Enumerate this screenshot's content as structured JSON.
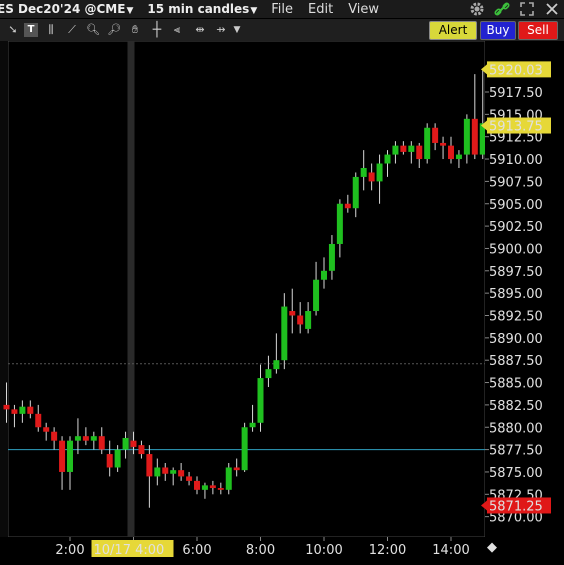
{
  "titlebar": {
    "symbol": "ES Dec20'24 @CME",
    "interval": "15 min candles",
    "menu": [
      "File",
      "Edit",
      "View"
    ]
  },
  "toolbar": {
    "tools": [
      "arrow-cursor-icon",
      "text-tool-icon",
      "bar-tool-icon",
      "line-tool-icon",
      "zoom-in-icon",
      "zoom-out-icon",
      "pan-hand-icon",
      "crosshair-icon",
      "compare-icon",
      "expand-icon",
      "dropdown-icon"
    ],
    "alert_label": "Alert",
    "buy_label": "Buy",
    "sell_label": "Sell"
  },
  "colors": {
    "up": "#1fc01f",
    "down": "#e01a1a",
    "last_price_bg": "#e6d838",
    "sell_price_bg": "#e01818",
    "grid": "#1a1a1a",
    "reference_line": "#2fa0c0",
    "date_highlight_bg": "#e6d838"
  },
  "chart_data": {
    "type": "candlestick",
    "price_ticks": [
      "5917.50",
      "5915.00",
      "5912.50",
      "5910.00",
      "5907.50",
      "5905.00",
      "5902.50",
      "5900.00",
      "5897.50",
      "5895.00",
      "5892.50",
      "5890.00",
      "5887.50",
      "5885.00",
      "5882.50",
      "5880.00",
      "5877.50",
      "5875.00",
      "5872.50",
      "5870.00"
    ],
    "time_ticks": [
      "2:00",
      "4:00",
      "6:00",
      "8:00",
      "10:00",
      "12:00",
      "14:00"
    ],
    "price_labels": {
      "high_marker": "5920.03",
      "last_price": "5913.75",
      "sell_price": "5871.25"
    },
    "reference_price": 5877.5,
    "dashed_level": 5887.1,
    "date_label": "10/17",
    "candles": [
      {
        "t": "0:00",
        "o": 5882.5,
        "h": 5885.0,
        "l": 5880.5,
        "c": 5882.0
      },
      {
        "t": "0:15",
        "o": 5882.0,
        "h": 5882.5,
        "l": 5880.0,
        "c": 5881.5
      },
      {
        "t": "0:30",
        "o": 5881.5,
        "h": 5883.0,
        "l": 5880.5,
        "c": 5882.3
      },
      {
        "t": "0:45",
        "o": 5882.3,
        "h": 5883.0,
        "l": 5881.0,
        "c": 5881.5
      },
      {
        "t": "1:00",
        "o": 5881.5,
        "h": 5882.5,
        "l": 5879.5,
        "c": 5880.0
      },
      {
        "t": "1:15",
        "o": 5880.0,
        "h": 5880.5,
        "l": 5878.5,
        "c": 5879.5
      },
      {
        "t": "1:30",
        "o": 5879.5,
        "h": 5880.0,
        "l": 5877.5,
        "c": 5878.5
      },
      {
        "t": "1:45",
        "o": 5878.5,
        "h": 5879.0,
        "l": 5873.0,
        "c": 5875.0
      },
      {
        "t": "2:00",
        "o": 5875.0,
        "h": 5879.0,
        "l": 5873.0,
        "c": 5878.5
      },
      {
        "t": "2:15",
        "o": 5878.5,
        "h": 5881.0,
        "l": 5877.0,
        "c": 5879.0
      },
      {
        "t": "2:30",
        "o": 5879.0,
        "h": 5880.0,
        "l": 5878.0,
        "c": 5878.5
      },
      {
        "t": "2:45",
        "o": 5878.5,
        "h": 5879.5,
        "l": 5877.5,
        "c": 5879.0
      },
      {
        "t": "3:00",
        "o": 5879.0,
        "h": 5880.0,
        "l": 5877.0,
        "c": 5877.5
      },
      {
        "t": "3:15",
        "o": 5877.0,
        "h": 5878.5,
        "l": 5874.5,
        "c": 5875.5
      },
      {
        "t": "3:30",
        "o": 5875.5,
        "h": 5878.0,
        "l": 5875.0,
        "c": 5877.5
      },
      {
        "t": "3:45",
        "o": 5877.5,
        "h": 5879.5,
        "l": 5876.5,
        "c": 5878.8
      },
      {
        "t": "4:00",
        "o": 5878.5,
        "h": 5879.5,
        "l": 5877.0,
        "c": 5877.8
      },
      {
        "t": "4:15",
        "o": 5878.0,
        "h": 5878.5,
        "l": 5876.5,
        "c": 5877.0
      },
      {
        "t": "4:30",
        "o": 5877.0,
        "h": 5878.0,
        "l": 5871.0,
        "c": 5874.5
      },
      {
        "t": "4:45",
        "o": 5874.5,
        "h": 5876.5,
        "l": 5873.5,
        "c": 5875.5
      },
      {
        "t": "5:00",
        "o": 5875.5,
        "h": 5876.0,
        "l": 5874.0,
        "c": 5874.8
      },
      {
        "t": "5:15",
        "o": 5874.8,
        "h": 5875.5,
        "l": 5873.5,
        "c": 5875.2
      },
      {
        "t": "5:30",
        "o": 5875.2,
        "h": 5876.0,
        "l": 5874.0,
        "c": 5874.5
      },
      {
        "t": "5:45",
        "o": 5874.5,
        "h": 5875.0,
        "l": 5873.5,
        "c": 5874.0
      },
      {
        "t": "6:00",
        "o": 5874.0,
        "h": 5874.5,
        "l": 5872.5,
        "c": 5873.0
      },
      {
        "t": "6:15",
        "o": 5873.0,
        "h": 5873.8,
        "l": 5872.0,
        "c": 5873.5
      },
      {
        "t": "6:30",
        "o": 5873.5,
        "h": 5874.0,
        "l": 5872.5,
        "c": 5873.2
      },
      {
        "t": "6:45",
        "o": 5873.2,
        "h": 5873.8,
        "l": 5872.5,
        "c": 5873.0
      },
      {
        "t": "7:00",
        "o": 5873.0,
        "h": 5876.0,
        "l": 5872.5,
        "c": 5875.5
      },
      {
        "t": "7:15",
        "o": 5875.5,
        "h": 5876.5,
        "l": 5874.5,
        "c": 5875.2
      },
      {
        "t": "7:30",
        "o": 5875.2,
        "h": 5880.5,
        "l": 5875.0,
        "c": 5880.0
      },
      {
        "t": "7:45",
        "o": 5880.0,
        "h": 5882.5,
        "l": 5879.5,
        "c": 5880.5
      },
      {
        "t": "8:00",
        "o": 5880.5,
        "h": 5887.0,
        "l": 5879.5,
        "c": 5885.5
      },
      {
        "t": "8:15",
        "o": 5885.5,
        "h": 5888.0,
        "l": 5884.5,
        "c": 5886.5
      },
      {
        "t": "8:30",
        "o": 5886.5,
        "h": 5890.5,
        "l": 5886.0,
        "c": 5887.5
      },
      {
        "t": "8:45",
        "o": 5887.5,
        "h": 5895.0,
        "l": 5886.5,
        "c": 5893.5
      },
      {
        "t": "9:00",
        "o": 5893.0,
        "h": 5895.5,
        "l": 5890.5,
        "c": 5892.5
      },
      {
        "t": "9:15",
        "o": 5892.5,
        "h": 5894.0,
        "l": 5890.5,
        "c": 5891.5
      },
      {
        "t": "9:30",
        "o": 5891.0,
        "h": 5894.0,
        "l": 5890.5,
        "c": 5893.0
      },
      {
        "t": "9:45",
        "o": 5893.0,
        "h": 5898.5,
        "l": 5892.5,
        "c": 5896.5
      },
      {
        "t": "10:00",
        "o": 5896.5,
        "h": 5899.0,
        "l": 5895.5,
        "c": 5897.5
      },
      {
        "t": "10:15",
        "o": 5897.5,
        "h": 5901.5,
        "l": 5896.5,
        "c": 5900.5
      },
      {
        "t": "10:30",
        "o": 5900.5,
        "h": 5905.5,
        "l": 5899.0,
        "c": 5905.0
      },
      {
        "t": "10:45",
        "o": 5905.0,
        "h": 5906.0,
        "l": 5904.0,
        "c": 5904.5
      },
      {
        "t": "11:00",
        "o": 5904.5,
        "h": 5908.5,
        "l": 5903.5,
        "c": 5908.0
      },
      {
        "t": "11:15",
        "o": 5908.0,
        "h": 5911.0,
        "l": 5906.5,
        "c": 5909.0
      },
      {
        "t": "11:30",
        "o": 5908.5,
        "h": 5909.5,
        "l": 5906.5,
        "c": 5907.5
      },
      {
        "t": "11:45",
        "o": 5907.5,
        "h": 5910.5,
        "l": 5905.0,
        "c": 5909.5
      },
      {
        "t": "12:00",
        "o": 5909.5,
        "h": 5911.0,
        "l": 5908.0,
        "c": 5910.5
      },
      {
        "t": "12:15",
        "o": 5910.5,
        "h": 5912.0,
        "l": 5909.5,
        "c": 5911.5
      },
      {
        "t": "12:30",
        "o": 5911.5,
        "h": 5912.0,
        "l": 5910.5,
        "c": 5910.8
      },
      {
        "t": "12:45",
        "o": 5910.8,
        "h": 5912.0,
        "l": 5909.5,
        "c": 5911.5
      },
      {
        "t": "13:00",
        "o": 5911.5,
        "h": 5911.8,
        "l": 5909.0,
        "c": 5910.0
      },
      {
        "t": "13:15",
        "o": 5910.0,
        "h": 5914.0,
        "l": 5909.5,
        "c": 5913.5
      },
      {
        "t": "13:30",
        "o": 5913.5,
        "h": 5914.0,
        "l": 5911.0,
        "c": 5911.8
      },
      {
        "t": "13:45",
        "o": 5911.8,
        "h": 5912.5,
        "l": 5910.0,
        "c": 5911.5
      },
      {
        "t": "14:00",
        "o": 5911.5,
        "h": 5912.5,
        "l": 5909.5,
        "c": 5910.0
      },
      {
        "t": "14:15",
        "o": 5910.0,
        "h": 5911.0,
        "l": 5909.0,
        "c": 5910.5
      },
      {
        "t": "14:30",
        "o": 5910.5,
        "h": 5915.0,
        "l": 5909.5,
        "c": 5914.5
      },
      {
        "t": "14:45",
        "o": 5914.5,
        "h": 5919.5,
        "l": 5910.0,
        "c": 5910.5
      },
      {
        "t": "15:00",
        "o": 5910.5,
        "h": 5920.0,
        "l": 5910.0,
        "c": 5914.0
      },
      {
        "t": "15:15",
        "o": 5914.0,
        "h": 5915.0,
        "l": 5912.0,
        "c": 5913.75
      }
    ]
  }
}
